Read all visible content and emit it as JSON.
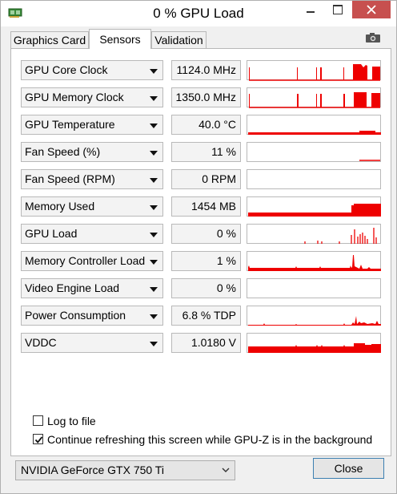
{
  "window": {
    "title": "0 % GPU Load",
    "app_icon": "gpu-card-icon"
  },
  "tabs": [
    {
      "label": "Graphics Card"
    },
    {
      "label": "Sensors",
      "active": true
    },
    {
      "label": "Validation"
    }
  ],
  "toolbar": {
    "screenshot_icon": "camera-icon"
  },
  "colors": {
    "graph": "#ee0000",
    "accent": "#3c7fb1",
    "close_hover": "#c7504f"
  },
  "sensors": [
    {
      "name": "GPU Core Clock",
      "value": "1124.0 MHz"
    },
    {
      "name": "GPU Memory Clock",
      "value": "1350.0 MHz"
    },
    {
      "name": "GPU Temperature",
      "value": "40.0 °C"
    },
    {
      "name": "Fan Speed (%)",
      "value": "11 %"
    },
    {
      "name": "Fan Speed (RPM)",
      "value": "0 RPM"
    },
    {
      "name": "Memory Used",
      "value": "1454 MB"
    },
    {
      "name": "GPU Load",
      "value": "0 %"
    },
    {
      "name": "Memory Controller Load",
      "value": "1 %"
    },
    {
      "name": "Video Engine Load",
      "value": "0 %"
    },
    {
      "name": "Power Consumption",
      "value": "6.8 % TDP"
    },
    {
      "name": "VDDC",
      "value": "1.0180 V"
    }
  ],
  "options": {
    "log_to_file": {
      "label": "Log to file",
      "checked": false
    },
    "continue_refresh": {
      "label": "Continue refreshing this screen while GPU-Z is in the background",
      "checked": true
    }
  },
  "footer": {
    "gpu_select": "NVIDIA GeForce GTX 750 Ti",
    "close_label": "Close"
  }
}
